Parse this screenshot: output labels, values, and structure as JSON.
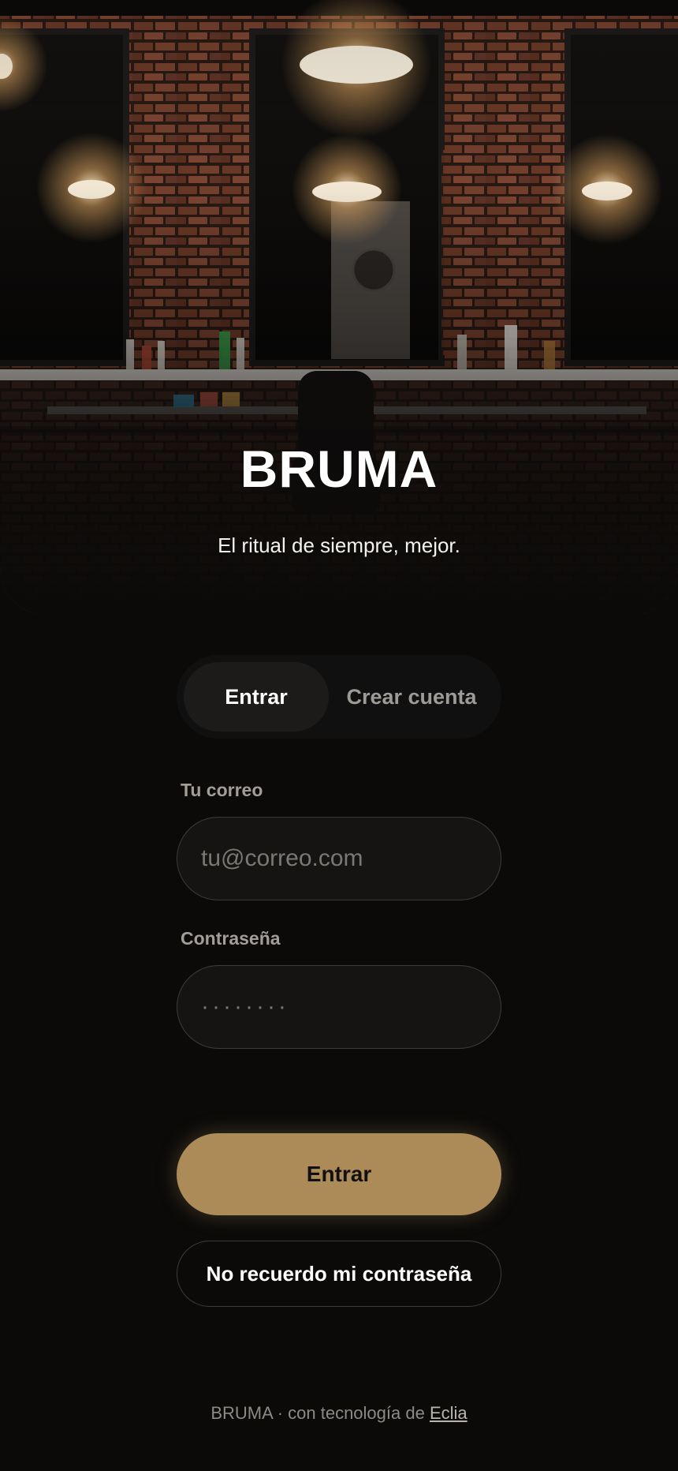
{
  "hero": {
    "brand": "BRUMA",
    "tagline": "El ritual de siempre, mejor."
  },
  "tabs": {
    "login_label": "Entrar",
    "signup_label": "Crear cuenta",
    "active": "login"
  },
  "form": {
    "email_label": "Tu correo",
    "email_placeholder": "tu@correo.com",
    "email_value": "",
    "password_label": "Contraseña",
    "password_placeholder": "········",
    "password_value": ""
  },
  "actions": {
    "submit_label": "Entrar",
    "forgot_label": "No recuerdo mi contraseña"
  },
  "footer": {
    "prefix": "BRUMA · con tecnología de ",
    "link_label": "Eclia"
  },
  "colors": {
    "background": "#0b0a09",
    "accent": "#ad8b59",
    "field_bg": "#151413",
    "field_border": "#3e3c3a"
  },
  "icons": [
    "hero-photo"
  ]
}
